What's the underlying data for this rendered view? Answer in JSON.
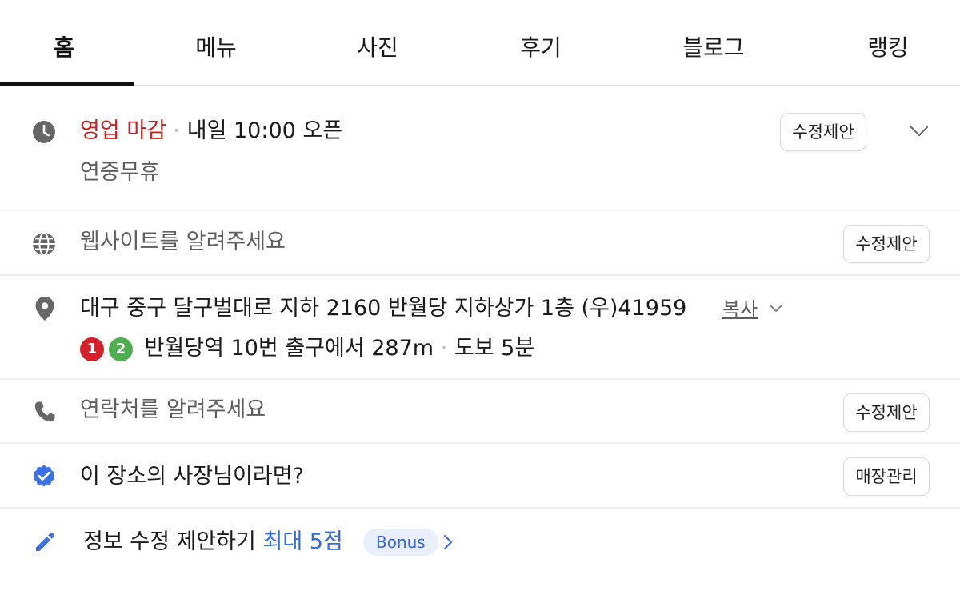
{
  "tabs": [
    {
      "label": "홈"
    },
    {
      "label": "메뉴"
    },
    {
      "label": "사진"
    },
    {
      "label": "후기"
    },
    {
      "label": "블로그"
    },
    {
      "label": "랭킹"
    }
  ],
  "hours": {
    "status": "영업 마감",
    "separator": "·",
    "next_open": "내일 10:00 오픈",
    "holiday": "연중무휴",
    "suggest_button": "수정제안"
  },
  "website": {
    "placeholder_text": "웹사이트를 알려주세요",
    "suggest_button": "수정제안"
  },
  "address": {
    "text": "대구 중구 달구벌대로 지하 2160 반월당 지하상가 1층 (우)41959",
    "copy_label": "복사",
    "line1_badge": "1",
    "line2_badge": "2",
    "line1_color": "#d2232a",
    "line2_color": "#4fae4d",
    "directions": "반월당역 10번 출구에서 287m",
    "separator": "·",
    "walk": "도보 5분"
  },
  "phone": {
    "placeholder_text": "연락처를 알려주세요",
    "suggest_button": "수정제안"
  },
  "owner": {
    "question": "이 장소의 사장님이라면?",
    "manage_button": "매장관리"
  },
  "edit_suggest": {
    "label": "정보 수정 제안하기",
    "max_points": "최대 5점",
    "bonus": "Bonus"
  },
  "icons": {
    "clock": "clock-icon",
    "globe": "globe-icon",
    "pin": "location-pin-icon",
    "phone": "phone-icon",
    "verified": "verified-badge-icon",
    "pencil": "pencil-icon",
    "chevron_down": "chevron-down-icon",
    "chevron_right": "chevron-right-icon"
  },
  "colors": {
    "status_closed": "#c8211f",
    "accent_blue": "#2f6be5",
    "verified_blue": "#3b73e6"
  }
}
